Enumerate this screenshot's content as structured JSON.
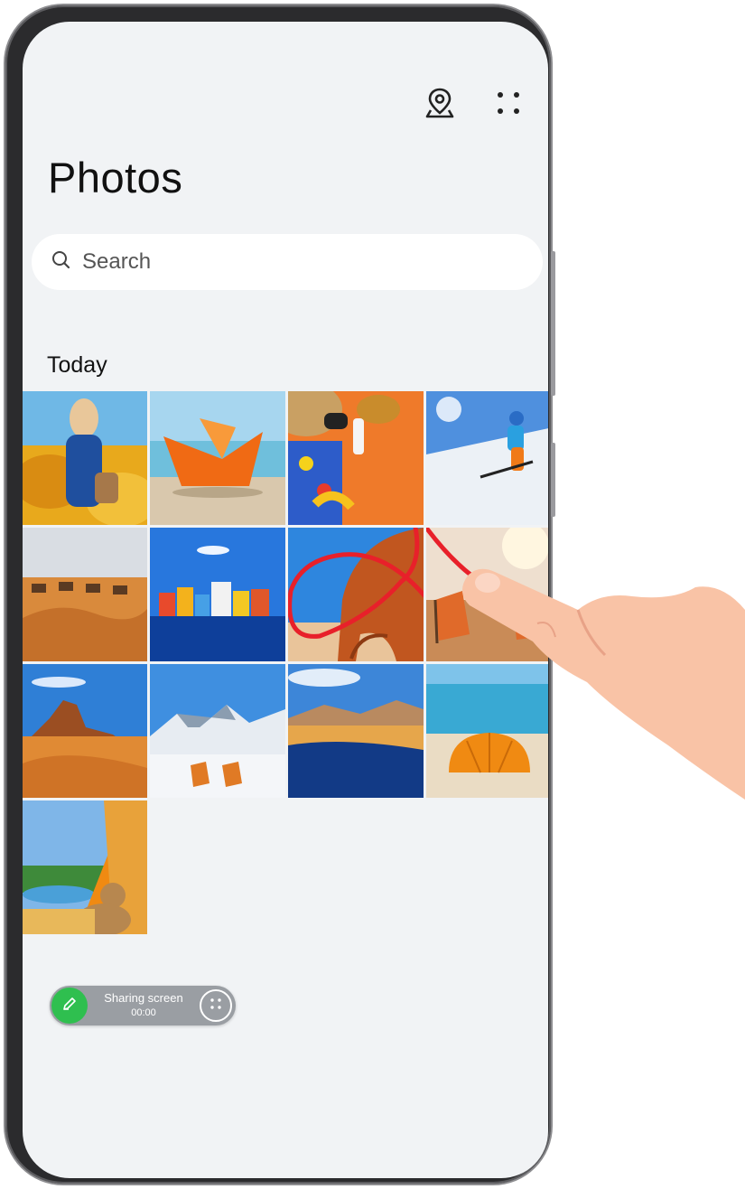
{
  "header": {
    "title": "Photos",
    "icons": [
      "map-pin-icon",
      "more-options-icon"
    ]
  },
  "search": {
    "placeholder": "Search"
  },
  "section": {
    "label": "Today"
  },
  "photos": [
    "woman-in-flower-field",
    "paper-boat-on-beach",
    "beach-accessories-on-orange",
    "skier-on-slope",
    "camel-caravan-in-desert",
    "colorful-waterfront-houses",
    "coastal-rock-arch",
    "beach-loungers",
    "desert-rock-formation",
    "snowy-mountain-loungers",
    "desert-lake",
    "orange-umbrella-on-beach",
    "tent-with-teddy-bear"
  ],
  "annotation": {
    "color": "#e8202a"
  },
  "sharing": {
    "label": "Sharing screen",
    "timer": "00:00",
    "accent": "#2fbf4f"
  }
}
